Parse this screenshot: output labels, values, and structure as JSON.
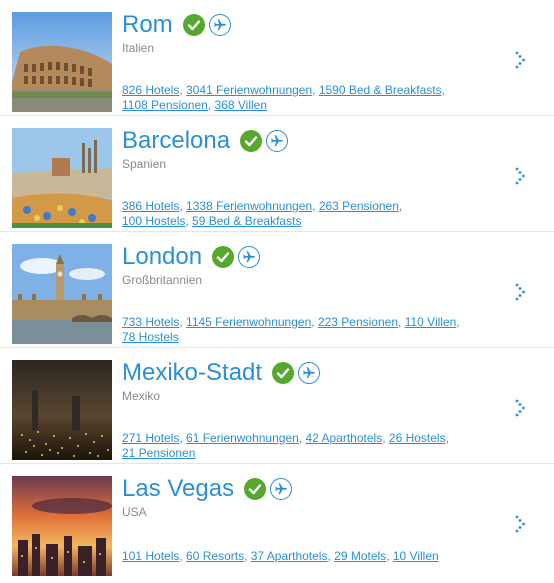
{
  "destinations": [
    {
      "name": "Rom",
      "country": "Italien",
      "links": [
        "826 Hotels",
        "3041 Ferienwohnungen",
        "1590 Bed & Breakfasts",
        "1108 Pensionen",
        "368 Villen"
      ]
    },
    {
      "name": "Barcelona",
      "country": "Spanien",
      "links": [
        "386 Hotels",
        "1338 Ferienwohnungen",
        "263 Pensionen",
        "100 Hostels",
        "59 Bed & Breakfasts"
      ]
    },
    {
      "name": "London",
      "country": "Großbritannien",
      "links": [
        "733 Hotels",
        "1145 Ferienwohnungen",
        "223 Pensionen",
        "110 Villen",
        "78 Hostels"
      ]
    },
    {
      "name": "Mexiko-Stadt",
      "country": "Mexiko",
      "links": [
        "271 Hotels",
        "61 Ferienwohnungen",
        "42 Aparthotels",
        "26 Hostels",
        "21 Pensionen"
      ]
    },
    {
      "name": "Las Vegas",
      "country": "USA",
      "links": [
        "101 Hotels",
        "60 Resorts",
        "37 Aparthotels",
        "29 Motels",
        "10 Villen"
      ]
    }
  ],
  "colors": {
    "link": "#2b8fd6",
    "check_badge": "#55a82d",
    "country_text": "#8a8a8a"
  },
  "icons": {
    "verified": "check-circle-icon",
    "flights": "airplane-icon",
    "more": "dotted-chevron-right-icon"
  }
}
